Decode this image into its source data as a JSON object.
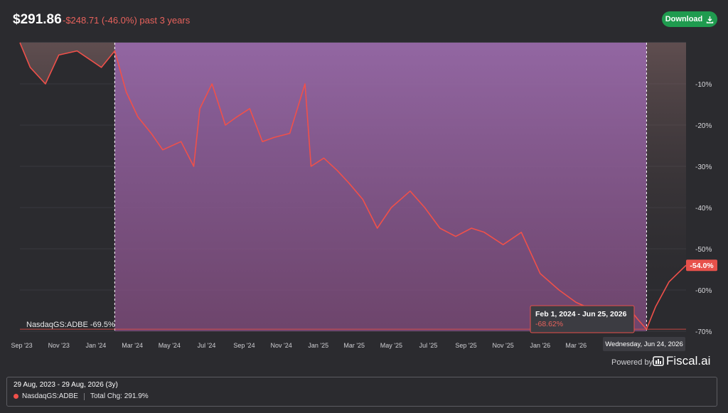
{
  "header": {
    "price": "$291.86",
    "change": "-$248.71 (-46.0%) past 3 years",
    "download_label": "Download"
  },
  "chart_data": {
    "type": "line",
    "series": [
      {
        "name": "NasdaqGS:ADBE",
        "x": [
          "2023-08-29",
          "2023-09-15",
          "2023-10-10",
          "2023-11-01",
          "2023-12-01",
          "2024-01-10",
          "2024-02-01",
          "2024-02-20",
          "2024-03-10",
          "2024-04-01",
          "2024-04-20",
          "2024-05-20",
          "2024-06-10",
          "2024-06-20",
          "2024-07-10",
          "2024-08-01",
          "2024-08-20",
          "2024-09-10",
          "2024-10-01",
          "2024-10-20",
          "2024-11-15",
          "2024-12-10",
          "2024-12-20",
          "2025-01-10",
          "2025-02-01",
          "2025-02-20",
          "2025-03-15",
          "2025-04-08",
          "2025-05-01",
          "2025-06-01",
          "2025-06-25",
          "2025-07-20",
          "2025-08-15",
          "2025-09-10",
          "2025-10-01",
          "2025-11-01",
          "2025-12-01",
          "2026-01-01",
          "2026-02-01",
          "2026-03-01",
          "2026-04-01",
          "2026-05-01",
          "2026-05-25",
          "2026-06-10",
          "2026-06-25",
          "2026-07-10",
          "2026-08-01",
          "2026-08-29"
        ],
        "values": [
          0,
          -6,
          -10,
          -3,
          -2,
          -6,
          -2,
          -12,
          -18,
          -22,
          -26,
          -24,
          -30,
          -16,
          -10,
          -20,
          -18,
          -16,
          -24,
          -23,
          -22,
          -10,
          -30,
          -28,
          -31,
          -34,
          -38,
          -45,
          -40,
          -36,
          -40,
          -45,
          -47,
          -45,
          -46,
          -49,
          -46,
          -56,
          -60,
          -63,
          -65,
          -66,
          -64,
          -67,
          -69.5,
          -64,
          -58,
          -54
        ]
      }
    ],
    "highlight": {
      "label": "Feb 1, 2024 - Jun 25, 2026",
      "value": "-68.62%",
      "start": "2024-02-01",
      "end": "2026-06-25"
    },
    "baseline_label": "NasdaqGS:ADBE -69.5%",
    "last_value_label": "-54.0%",
    "hover_date": "Wednesday, Jun 24, 2026",
    "y_ticks": [
      "-10%",
      "-20%",
      "-30%",
      "-40%",
      "-50%",
      "-60%",
      "-70%"
    ],
    "y_tick_values": [
      -10,
      -20,
      -30,
      -40,
      -50,
      -60,
      -70
    ],
    "ylim": [
      0,
      -70
    ],
    "x_ticks": [
      "Sep '23",
      "Nov '23",
      "Jan '24",
      "Mar '24",
      "May '24",
      "Jul '24",
      "Sep '24",
      "Nov '24",
      "Jan '25",
      "Mar '25",
      "May '25",
      "Jul '25",
      "Sep '25",
      "Nov '25",
      "Jan '26",
      "Mar '26"
    ],
    "x_tick_dates": [
      "2023-09-01",
      "2023-11-01",
      "2024-01-01",
      "2024-03-01",
      "2024-05-01",
      "2024-07-01",
      "2024-09-01",
      "2024-11-01",
      "2025-01-01",
      "2025-03-01",
      "2025-05-01",
      "2025-07-01",
      "2025-09-01",
      "2025-11-01",
      "2026-01-01",
      "2026-03-01"
    ],
    "line_color": "#f0504a",
    "highlight_color": "#9a6aae"
  },
  "footer": {
    "powered_by": "Powered by",
    "brand": "Fiscal.ai",
    "range": "29 Aug, 2023 - 29 Aug, 2026 (3y)",
    "ticker": "NasdaqGS:ADBE",
    "total_change": "Total Chg: 291.9%"
  }
}
